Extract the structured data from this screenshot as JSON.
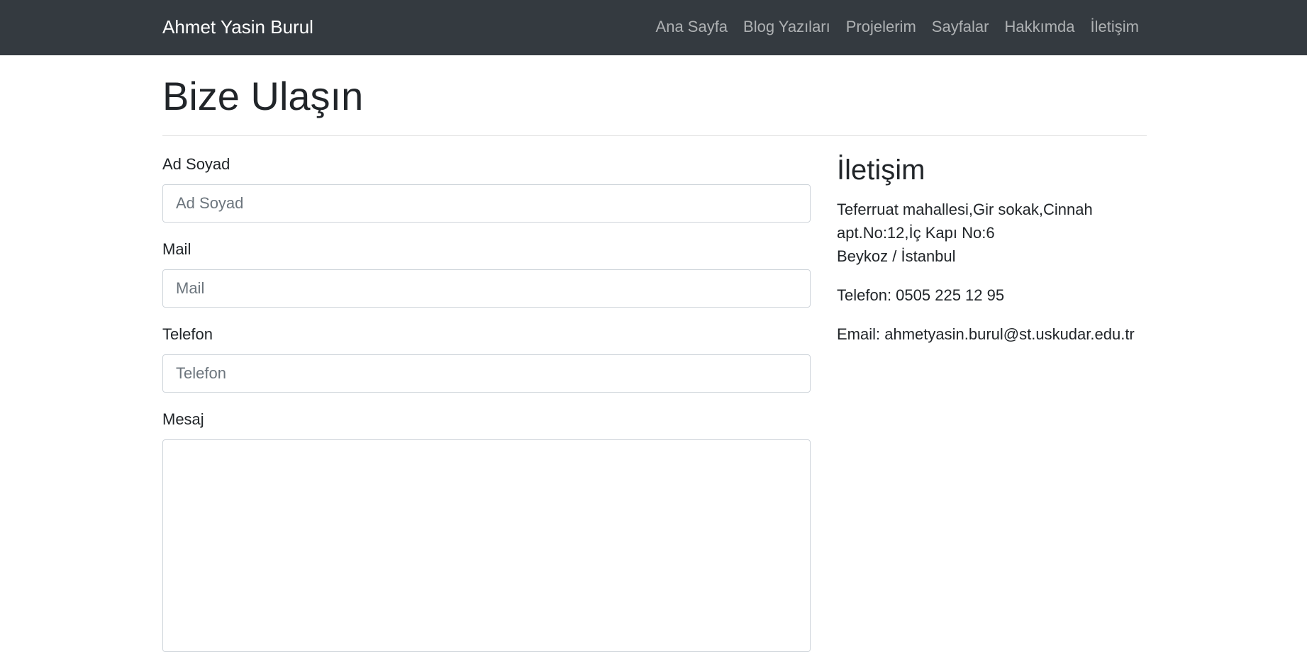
{
  "navbar": {
    "brand": "Ahmet Yasin Burul",
    "links": [
      "Ana Sayfa",
      "Blog Yazıları",
      "Projelerim",
      "Sayfalar",
      "Hakkımda",
      "İletişim"
    ]
  },
  "page": {
    "title": "Bize Ulaşın"
  },
  "form": {
    "name": {
      "label": "Ad Soyad",
      "placeholder": "Ad Soyad"
    },
    "mail": {
      "label": "Mail",
      "placeholder": "Mail"
    },
    "phone": {
      "label": "Telefon",
      "placeholder": "Telefon"
    },
    "message": {
      "label": "Mesaj"
    }
  },
  "contact": {
    "title": "İletişim",
    "address_line1": "Teferruat mahallesi,Gir sokak,Cinnah",
    "address_line2": "apt.No:12,İç Kapı No:6",
    "address_line3": "Beykoz / İstanbul",
    "phone": "Telefon: 0505 225 12 95",
    "email": "Email: ahmetyasin.burul@st.uskudar.edu.tr"
  },
  "colors": {
    "navbar_bg": "#343a40",
    "text": "#212529"
  }
}
